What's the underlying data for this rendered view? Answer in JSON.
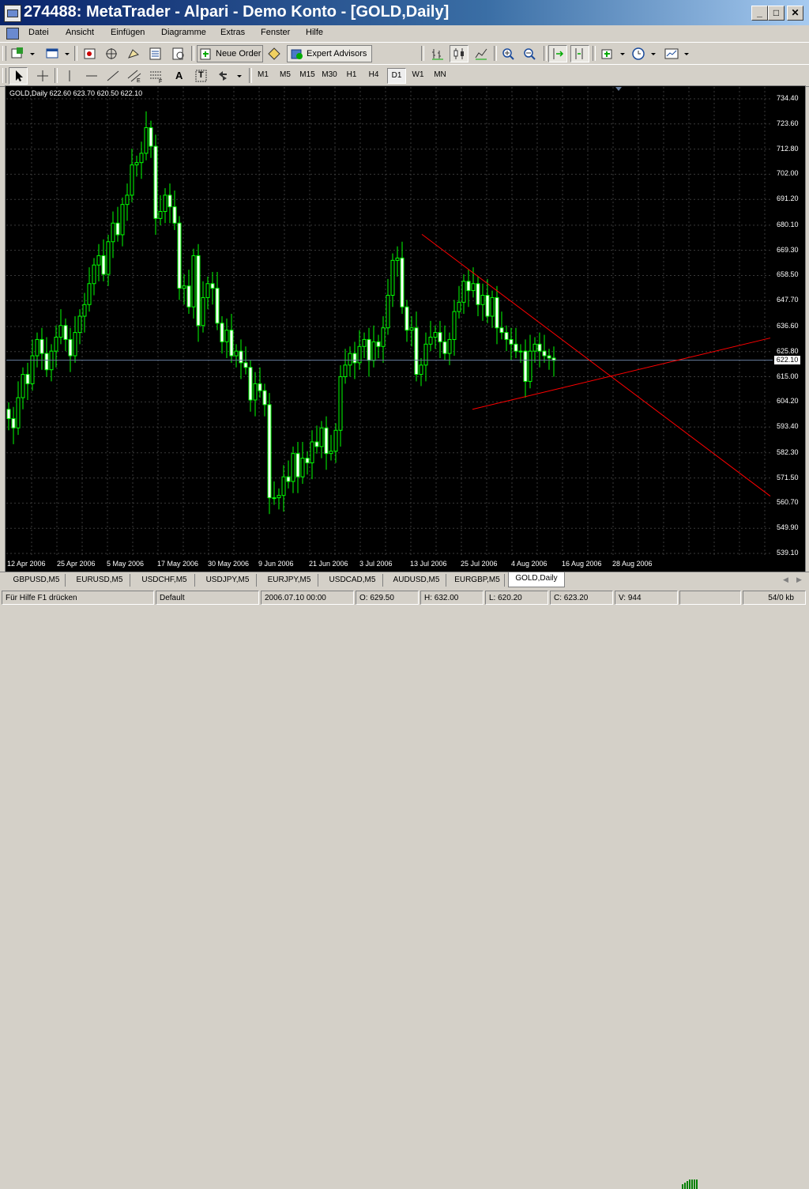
{
  "window": {
    "title": "274488: MetaTrader - Alpari - Demo Konto - [GOLD,Daily]",
    "minimize": "_",
    "maximize": "□",
    "close": "✕"
  },
  "menu": {
    "items": [
      "Datei",
      "Ansicht",
      "Einfügen",
      "Diagramme",
      "Extras",
      "Fenster",
      "Hilfe"
    ]
  },
  "toolbar": {
    "new_order": "Neue Order",
    "expert_advisors": "Expert Advisors",
    "icons": [
      "new-chart-icon",
      "profiles-icon",
      "market-watch-icon",
      "navigator-icon",
      "data-window-icon",
      "terminal-icon",
      "tester-icon",
      "new-order-icon",
      "metaeditor-icon",
      "expert-advisors-icon",
      "bar-chart-icon",
      "candlestick-icon",
      "line-chart-icon",
      "zoom-in-icon",
      "zoom-out-icon",
      "autoscroll-icon",
      "chart-shift-icon",
      "indicators-icon",
      "periods-icon",
      "templates-icon"
    ]
  },
  "drawing_toolbar": {
    "text_tool": "A",
    "label_tool": "T",
    "timeframes": [
      "M1",
      "M5",
      "M15",
      "M30",
      "H1",
      "H4",
      "D1",
      "W1",
      "MN"
    ],
    "active_timeframe": "D1"
  },
  "chart": {
    "header": "GOLD,Daily  622.60 623.70 620.50 622.10",
    "current_price": "622.10",
    "colors": {
      "background": "#000000",
      "grid": "#3a3a3a",
      "bull": "#00ff00",
      "bear_fill": "#ffffff",
      "trendline": "#ff0000"
    },
    "price_labels": [
      "734.40",
      "723.60",
      "712.80",
      "702.00",
      "691.20",
      "680.10",
      "669.30",
      "658.50",
      "647.70",
      "636.60",
      "625.80",
      "615.00",
      "604.20",
      "593.40",
      "582.30",
      "571.50",
      "560.70",
      "549.90",
      "539.10"
    ],
    "date_labels": [
      "12 Apr 2006",
      "25 Apr 2006",
      "5 May 2006",
      "17 May 2006",
      "30 May 2006",
      "9 Jun 2006",
      "21 Jun 2006",
      "3 Jul 2006",
      "13 Jul 2006",
      "25 Jul 2006",
      "4 Aug 2006",
      "16 Aug 2006",
      "28 Aug 2006"
    ]
  },
  "tabs": [
    "GBPUSD,M5",
    "EURUSD,M5",
    "USDCHF,M5",
    "USDJPY,M5",
    "EURJPY,M5",
    "USDCAD,M5",
    "AUDUSD,M5",
    "EURGBP,M5",
    "GOLD,Daily"
  ],
  "active_tab": "GOLD,Daily",
  "status": {
    "help": "Für Hilfe F1 drücken",
    "profile": "Default",
    "datetime": "2006.07.10 00:00",
    "open": "O: 629.50",
    "high": "H: 632.00",
    "low": "L: 620.20",
    "close": "C: 623.20",
    "volume": "V: 944",
    "traffic": "54/0 kb"
  },
  "chart_data": {
    "type": "candlestick",
    "symbol": "GOLD",
    "timeframe": "Daily",
    "ylim": [
      539.1,
      734.4
    ],
    "x_ticks": [
      "12 Apr 2006",
      "25 Apr 2006",
      "5 May 2006",
      "17 May 2006",
      "30 May 2006",
      "9 Jun 2006",
      "21 Jun 2006",
      "3 Jul 2006",
      "13 Jul 2006",
      "25 Jul 2006",
      "4 Aug 2006",
      "16 Aug 2006",
      "28 Aug 2006"
    ],
    "last_bar": {
      "open": 622.6,
      "high": 623.7,
      "low": 620.5,
      "close": 622.1
    },
    "closes": [
      597,
      593,
      606,
      616,
      612,
      624,
      631,
      625,
      618,
      626,
      632,
      637,
      631,
      624,
      634,
      641,
      646,
      655,
      663,
      667,
      659,
      673,
      681,
      676,
      689,
      693,
      706,
      707,
      711,
      722,
      714,
      683,
      686,
      693,
      688,
      681,
      653,
      654,
      645,
      667,
      637,
      649,
      655,
      653,
      638,
      630,
      635,
      624,
      626,
      621,
      619,
      605,
      612,
      609,
      603,
      563,
      563,
      564,
      572,
      570,
      582,
      572,
      580,
      578,
      587,
      585,
      593,
      582,
      583,
      592,
      615,
      620,
      625,
      621,
      628,
      631,
      622,
      630,
      628,
      636,
      650,
      665,
      666,
      645,
      635,
      636,
      616,
      620,
      629,
      632,
      634,
      630,
      625,
      631,
      643,
      647,
      656,
      652,
      655,
      646,
      650,
      641,
      649,
      636,
      634,
      631,
      629,
      626,
      626,
      613,
      626,
      629,
      626,
      624,
      623,
      622
    ],
    "trendlines": [
      {
        "from": {
          "date": "13 Jul 2006",
          "price": 676.2
        },
        "to": {
          "date": "28 Aug 2006",
          "price": 610.9
        }
      },
      {
        "from": {
          "date": "25 Jul 2006",
          "price": 601.0
        },
        "to": {
          "date": "28 Aug 2006",
          "price": 616.6
        }
      }
    ]
  }
}
